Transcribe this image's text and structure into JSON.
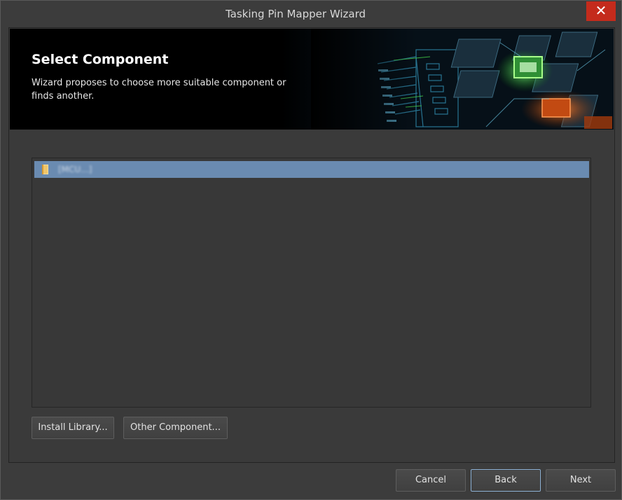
{
  "window": {
    "title": "Tasking Pin Mapper Wizard",
    "close_glyph": "✕"
  },
  "banner": {
    "title": "Select Component",
    "description": "Wizard proposes to choose more suitable component or finds another."
  },
  "component_list": {
    "items": [
      {
        "label": "[MCU...]",
        "icon": "folder-icon",
        "selected": true
      }
    ]
  },
  "actions": {
    "install_library": "Install Library...",
    "other_component": "Other Component..."
  },
  "footer": {
    "cancel": "Cancel",
    "back": "Back",
    "next": "Next"
  },
  "colors": {
    "selection": "#6a8bb1",
    "close_button": "#c42b1c",
    "window_bg": "#3c3c3c"
  }
}
